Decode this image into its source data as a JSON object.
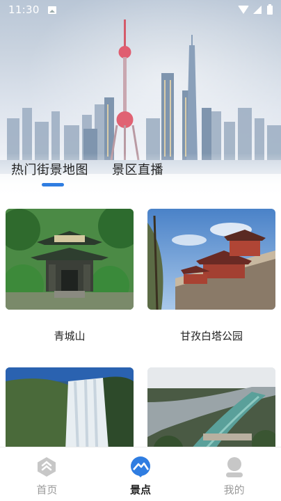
{
  "status_bar": {
    "time": "11:30"
  },
  "hero": {
    "tabs": [
      {
        "label": "热门街景地图",
        "active": true
      },
      {
        "label": "景区直播",
        "active": false
      }
    ]
  },
  "cards": [
    {
      "title": "青城山"
    },
    {
      "title": "甘孜白塔公园"
    },
    {
      "title": ""
    },
    {
      "title": ""
    }
  ],
  "bottom_nav": {
    "items": [
      {
        "label": "首页",
        "icon": "home-hexagon-icon",
        "active": false
      },
      {
        "label": "景点",
        "icon": "mountain-pin-icon",
        "active": true
      },
      {
        "label": "我的",
        "icon": "user-avatar-icon",
        "active": false
      }
    ]
  },
  "colors": {
    "accent": "#2f7de1",
    "active_text": "#1c1c1c",
    "inactive_text": "#9a9a9a"
  }
}
